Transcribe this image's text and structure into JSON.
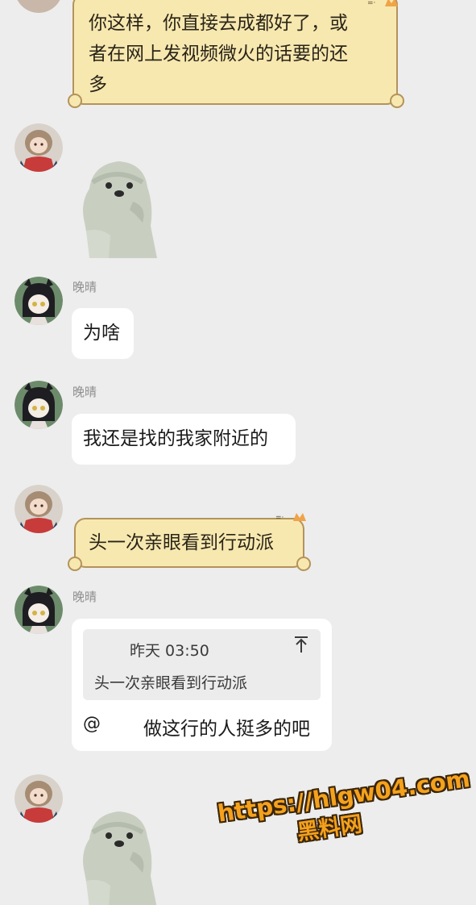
{
  "messages": {
    "m1_text": "你这样，你直接去成都好了，或者在网上发视频微火的话要的还多",
    "m1_line1": "你这样，你直接去成都好了，或",
    "m1_line2": "者在网上发视频微火的话要的还",
    "m1_line3": "多",
    "m3_sender": "晚晴",
    "m3_text": "为啥",
    "m4_sender": "晚晴",
    "m4_text": "我还是找的我家附近的",
    "m5_text": "头一次亲眼看到行动派",
    "m6_sender": "晚晴",
    "m6_quote_time": "昨天 03:50",
    "m6_quote_text": "头一次亲眼看到行动派",
    "m6_reply_at": "@",
    "m6_reply_text": "做这行的人挺多的吧"
  },
  "icons": {
    "quote_jump": "arrow-up-to-top-icon"
  },
  "watermark": {
    "url": "https://hlgw04.com",
    "name": "黑料网"
  },
  "colors": {
    "background": "#ededed",
    "scroll_bubble": "#f7e8b0",
    "scroll_border": "#b4935a",
    "watermark": "#f4a11d"
  }
}
